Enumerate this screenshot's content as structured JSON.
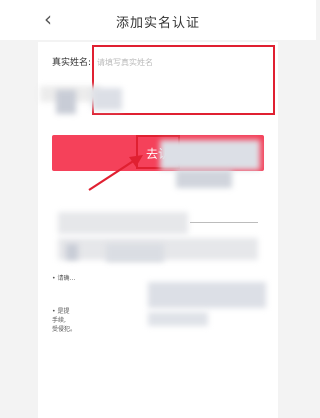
{
  "header": {
    "back_icon": "‹",
    "title": "添加实名认证"
  },
  "form": {
    "name_label": "真实姓名:",
    "name_placeholder": "请填写真实姓名"
  },
  "confirm_button": {
    "label": "去认"
  },
  "notes": [
    {
      "bullet": "•",
      "text": "请确…"
    },
    {
      "bullet": "•",
      "text": "是提\n手续,\n受侵犯。"
    }
  ],
  "colors": {
    "accent": "#f5415a",
    "annotation_red": "#e02031"
  }
}
